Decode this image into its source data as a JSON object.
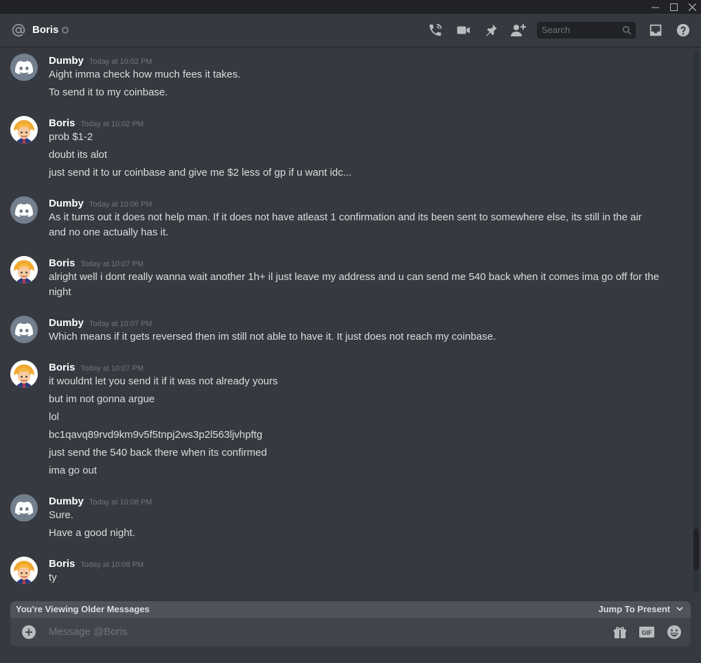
{
  "window": {
    "minimize_icon": "minimize-icon",
    "maximize_icon": "maximize-icon",
    "close_icon": "close-icon"
  },
  "header": {
    "name": "Boris",
    "search_placeholder": "Search",
    "icons": [
      "at-icon",
      "phone-call-icon",
      "video-call-icon",
      "pin-icon",
      "add-friend-icon",
      "inbox-icon",
      "help-icon"
    ]
  },
  "messages": [
    {
      "author": "Dumby",
      "timestamp": "Today at 10:02 PM",
      "avatar": "discord-logo",
      "lines": [
        "Aight imma check how much fees it takes.",
        "To send it to my coinbase."
      ]
    },
    {
      "author": "Boris",
      "timestamp": "Today at 10:02 PM",
      "avatar": "boris",
      "lines": [
        "prob $1-2",
        "doubt its alot",
        "just send it to ur coinbase and give me $2 less of gp if u want idc..."
      ]
    },
    {
      "author": "Dumby",
      "timestamp": "Today at 10:06 PM",
      "avatar": "discord-logo",
      "lines": [
        "As it turns out it does not help man. If it does not have atleast 1 confirmation and its been sent to somewhere else, its still in the air and no one actually has it."
      ]
    },
    {
      "author": "Boris",
      "timestamp": "Today at 10:07 PM",
      "avatar": "boris",
      "lines": [
        "alright well i dont really wanna wait another 1h+ il just leave my address and u can send me 540 back when it comes ima go off for the night"
      ]
    },
    {
      "author": "Dumby",
      "timestamp": "Today at 10:07 PM",
      "avatar": "discord-logo",
      "lines": [
        "Which means if it gets reversed then im still not able to have it. It just does not reach my coinbase."
      ]
    },
    {
      "author": "Boris",
      "timestamp": "Today at 10:07 PM",
      "avatar": "boris",
      "lines": [
        "it wouldnt let you send it if it was not already yours",
        "but im not gonna argue",
        "lol",
        "bc1qavq89rvd9km9v5f5tnpj2ws3p2l563ljvhpftg",
        "just send the 540 back there when its confirmed",
        "ima go out"
      ]
    },
    {
      "author": "Dumby",
      "timestamp": "Today at 10:08 PM",
      "avatar": "discord-logo",
      "lines": [
        "Sure.",
        "Have a good night."
      ]
    },
    {
      "author": "Boris",
      "timestamp": "Today at 10:08 PM",
      "avatar": "boris",
      "lines": [
        "ty"
      ]
    }
  ],
  "older_bar": {
    "notice": "You're Viewing Older Messages",
    "jump": "Jump To Present"
  },
  "composer": {
    "placeholder": "Message @Boris",
    "gif_label": "GIF",
    "icons": [
      "add-attachment-icon",
      "gift-icon",
      "gif-icon",
      "emoji-icon"
    ]
  },
  "colors": {
    "background": "#36393f",
    "titlebar": "#202225",
    "input": "#40444b",
    "muted": "#72767d",
    "text": "#dcddde"
  }
}
